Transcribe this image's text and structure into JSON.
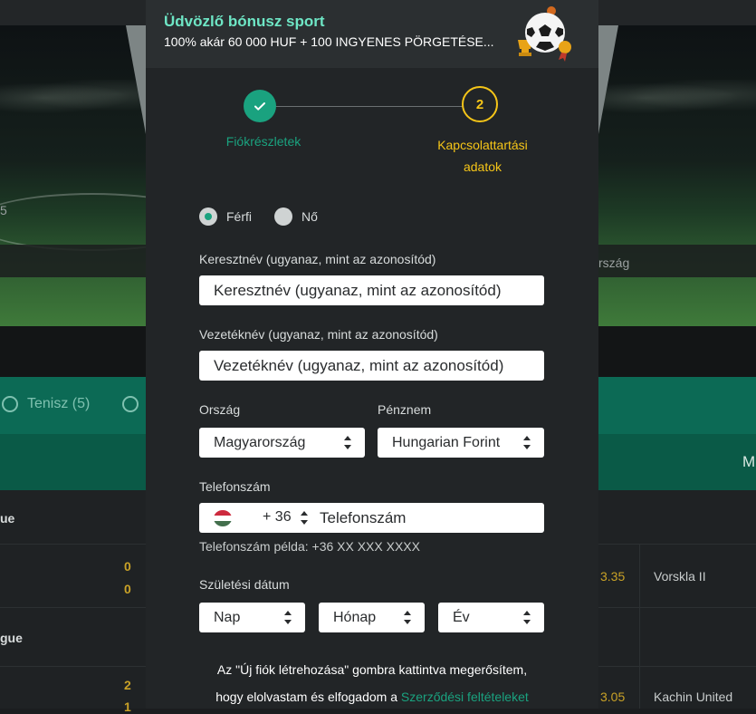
{
  "background": {
    "left_score_fragment": "5",
    "right_label_fragment": "rszág",
    "sport_tab_label": "Tenisz (5)",
    "right_header_fragment": "M",
    "league_label_1": "ue",
    "league_label_2": "gue",
    "left_scores": [
      "0",
      "0",
      "2",
      "1"
    ],
    "right_odds": [
      "3.35",
      "3.05"
    ],
    "right_teams": [
      "Vorskla II",
      "Kachin United"
    ]
  },
  "promo": {
    "title": "Üdvözlő bónusz sport",
    "subtitle": "100% akár 60 000 HUF + 100 INGYENES PÖRGETÉSE..."
  },
  "stepper": {
    "step1_label": "Fiókrészletek",
    "step2_number": "2",
    "step2_label_line1": "Kapcsolattartási",
    "step2_label_line2": "adatok"
  },
  "form": {
    "gender": {
      "male": "Férfi",
      "female": "Nő",
      "selected": "male"
    },
    "first_name": {
      "label": "Keresztnév (ugyanaz, mint az azonosítód)",
      "placeholder": "Keresztnév (ugyanaz, mint az azonosítód)"
    },
    "last_name": {
      "label": "Vezetéknév (ugyanaz, mint az azonosítód)",
      "placeholder": "Vezetéknév (ugyanaz, mint az azonosítód)"
    },
    "country": {
      "label": "Ország",
      "value": "Magyarország"
    },
    "currency": {
      "label": "Pénznem",
      "value": "Hungarian Forint"
    },
    "phone": {
      "label": "Telefonszám",
      "prefix": "+ 36",
      "placeholder": "Telefonszám",
      "hint": "Telefonszám példa: +36 XX XXX XXXX"
    },
    "birthdate": {
      "label": "Születési dátum",
      "day": "Nap",
      "month": "Hónap",
      "year": "Év"
    },
    "terms_text_1": "Az \"Új fiók létrehozása\" gombra kattintva megerősítem,",
    "terms_text_2": "hogy elolvastam és elfogadom a ",
    "terms_link": "Szerződési feltételeket"
  },
  "colors": {
    "accent_green": "#1aa27f",
    "promo_title": "#6ee6c5",
    "active_step": "#f5c518",
    "modal_bg": "#222527"
  }
}
